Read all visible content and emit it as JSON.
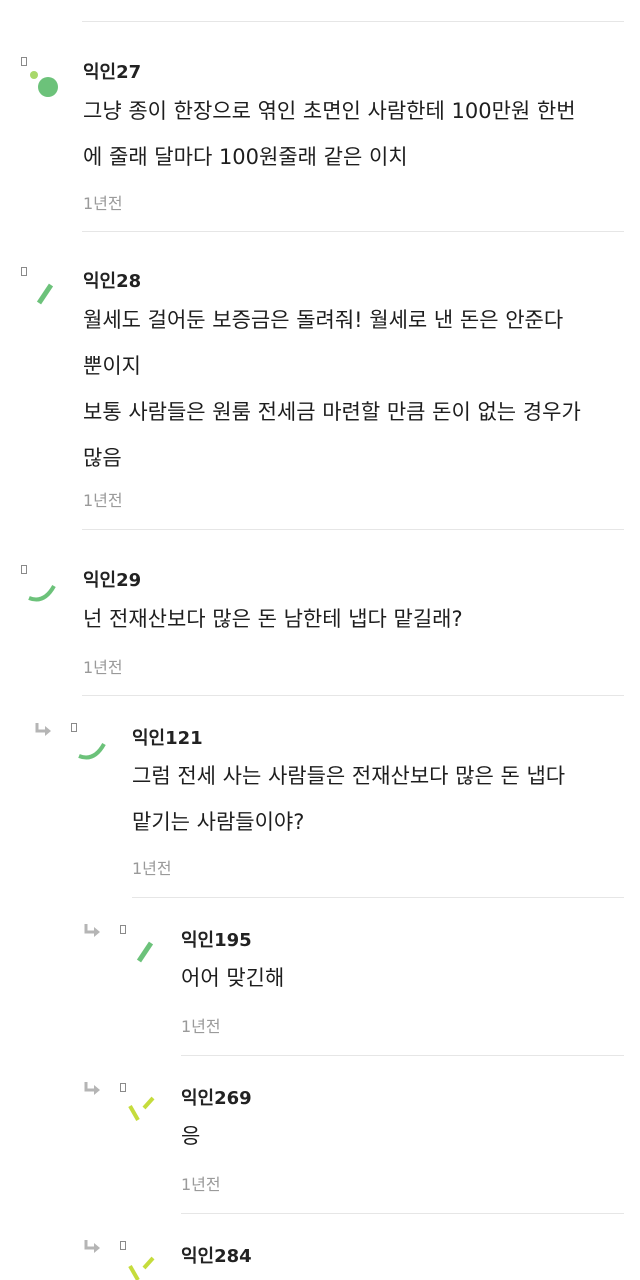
{
  "comments": [
    {
      "author": "익인27",
      "lines": [
        "그냥 종이 한장으로 엮인 초면인 사람한테 100만원 한번",
        "에 줄래 달마다 100원줄래 같은 이치"
      ],
      "time": "1년전",
      "avatar_icon": "green-dots-avatar-icon"
    },
    {
      "author": "익인28",
      "lines": [
        "월세도 걸어둔 보증금은 돌려줘! 월세로 낸 돈은 안준다",
        "뿐이지",
        "보통 사람들은 원룸 전세금 마련할 만큼 돈이 없는 경우가",
        "많음"
      ],
      "time": "1년전",
      "avatar_icon": "green-slash-avatar-icon"
    },
    {
      "author": "익인29",
      "lines": [
        "넌 전재산보다 많은 돈 남한테 냅다 맡길래?"
      ],
      "time": "1년전",
      "avatar_icon": "green-arc-avatar-icon"
    },
    {
      "author": "익인121",
      "lines": [
        "그럼 전세 사는 사람들은 전재산보다 많은 돈 냅다",
        "맡기는 사람들이야?"
      ],
      "time": "1년전",
      "avatar_icon": "green-arc-avatar-icon"
    },
    {
      "author": "익인195",
      "lines": [
        "어어 맞긴해"
      ],
      "time": "1년전",
      "avatar_icon": "green-slash-avatar-icon"
    },
    {
      "author": "익인269",
      "lines": [
        "응"
      ],
      "time": "1년전",
      "avatar_icon": "lime-chevron-avatar-icon"
    },
    {
      "author": "익인284",
      "lines": [],
      "time": "",
      "avatar_icon": "lime-chevron-avatar-icon"
    }
  ],
  "colors": {
    "avatar_green": "#6cc27a",
    "avatar_light_green": "#a8d86a",
    "avatar_lime": "#c5dc3c",
    "reply_arrow": "#b5b5b5",
    "meta_text": "#9a9a9a"
  },
  "icons": {
    "reply": "reply-arrow-icon",
    "avatar_badge": "avatar-badge-icon"
  }
}
